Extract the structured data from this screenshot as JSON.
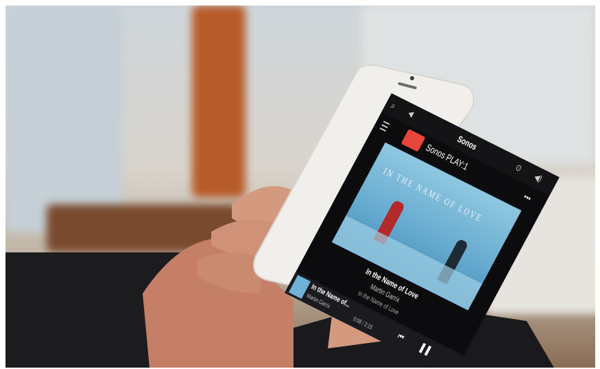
{
  "app": {
    "title": "Sonos",
    "room_name": "Sonos PLAY:1",
    "more_label": "•••"
  },
  "now_playing": {
    "album_cover_text": "IN THE NAME OF LOVE",
    "track_title": "In the Name of Love",
    "artist": "Martin Garrix",
    "album": "In the Name of Love"
  },
  "mini_player": {
    "track_title": "In the Name of...",
    "artist": "Martin Garrix",
    "time": "0:08 / 3:15"
  },
  "colors": {
    "accent_service": "#e8453c",
    "screen_bg": "#0c0c0e",
    "album_sky": "#6fb2d8"
  },
  "icons": [
    "search-icon",
    "back-icon",
    "menu-icon",
    "sonos-service-icon",
    "info-icon",
    "volume-icon",
    "more-icon",
    "previous-icon",
    "pause-icon",
    "home-button-icon"
  ]
}
